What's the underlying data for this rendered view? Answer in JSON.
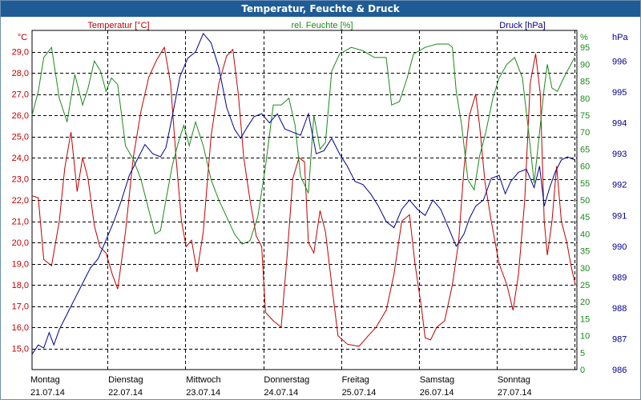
{
  "title": "Temperatur, Feuchte & Druck",
  "colors": {
    "temperature": "#c00000",
    "humidity": "#1a8a1a",
    "pressure": "#00008b",
    "titlebar": "#1f5c95",
    "grid": "#000000"
  },
  "chart_data": {
    "type": "line",
    "title": "Temperatur, Feuchte & Druck",
    "x_ticks": [
      {
        "day": "Montag",
        "date": "21.07.14"
      },
      {
        "day": "Dienstag",
        "date": "22.07.14"
      },
      {
        "day": "Mittwoch",
        "date": "23.07.14"
      },
      {
        "day": "Donnerstag",
        "date": "24.07.14"
      },
      {
        "day": "Freitag",
        "date": "25.07.14"
      },
      {
        "day": "Samstag",
        "date": "26.07.14"
      },
      {
        "day": "Sonntag",
        "date": "27.07.14"
      }
    ],
    "axes": {
      "temperature": {
        "label": "Temperatur [°C]",
        "unit": "°C",
        "ticks": [
          "15,0",
          "16,0",
          "17,0",
          "18,0",
          "19,0",
          "20,0",
          "21,0",
          "22,0",
          "23,0",
          "24,0",
          "25,0",
          "26,0",
          "27,0",
          "28,0",
          "29,0"
        ],
        "range": [
          14.0,
          30.0
        ]
      },
      "humidity": {
        "label": "rel. Feuchte [%]",
        "unit": "%",
        "ticks": [
          "0",
          "5",
          "10",
          "15",
          "20",
          "25",
          "30",
          "35",
          "40",
          "45",
          "50",
          "55",
          "60",
          "65",
          "70",
          "75",
          "80",
          "85",
          "90",
          "95"
        ],
        "range": [
          0,
          100
        ]
      },
      "pressure": {
        "label": "Druck [hPa]",
        "unit": "hPa",
        "ticks": [
          "986",
          "987",
          "988",
          "989",
          "990",
          "991",
          "992",
          "993",
          "994",
          "995",
          "996"
        ],
        "range": [
          986,
          997
        ]
      }
    },
    "grid": true,
    "x_range_days": [
      0,
      7
    ],
    "series": [
      {
        "name": "Temperatur [°C]",
        "axis": "temperature",
        "points": [
          [
            0,
            22.2
          ],
          [
            0.08,
            22.1
          ],
          [
            0.15,
            19.2
          ],
          [
            0.25,
            18.9
          ],
          [
            0.35,
            21.0
          ],
          [
            0.42,
            23.5
          ],
          [
            0.5,
            25.2
          ],
          [
            0.58,
            22.4
          ],
          [
            0.65,
            24.0
          ],
          [
            0.72,
            23.0
          ],
          [
            0.8,
            20.8
          ],
          [
            0.87,
            19.8
          ],
          [
            0.95,
            19.5
          ],
          [
            1.03,
            18.5
          ],
          [
            1.1,
            17.8
          ],
          [
            1.2,
            20.5
          ],
          [
            1.3,
            24.0
          ],
          [
            1.4,
            26.2
          ],
          [
            1.5,
            27.8
          ],
          [
            1.6,
            28.6
          ],
          [
            1.7,
            29.2
          ],
          [
            1.78,
            27.5
          ],
          [
            1.85,
            24.0
          ],
          [
            1.92,
            21.0
          ],
          [
            1.98,
            19.8
          ],
          [
            2.05,
            20.1
          ],
          [
            2.12,
            18.6
          ],
          [
            2.2,
            20.5
          ],
          [
            2.3,
            25.0
          ],
          [
            2.4,
            27.5
          ],
          [
            2.5,
            28.8
          ],
          [
            2.58,
            29.1
          ],
          [
            2.65,
            27.0
          ],
          [
            2.72,
            24.0
          ],
          [
            2.8,
            22.0
          ],
          [
            2.88,
            20.3
          ],
          [
            2.95,
            19.8
          ],
          [
            3.0,
            16.7
          ],
          [
            3.1,
            16.3
          ],
          [
            3.2,
            16.0
          ],
          [
            3.28,
            19.5
          ],
          [
            3.35,
            23.0
          ],
          [
            3.43,
            24.0
          ],
          [
            3.5,
            23.8
          ],
          [
            3.55,
            20.0
          ],
          [
            3.62,
            19.5
          ],
          [
            3.7,
            21.5
          ],
          [
            3.77,
            20.5
          ],
          [
            3.85,
            18.0
          ],
          [
            3.93,
            15.6
          ],
          [
            4.05,
            15.2
          ],
          [
            4.2,
            15.1
          ],
          [
            4.32,
            15.6
          ],
          [
            4.42,
            16.0
          ],
          [
            4.55,
            16.8
          ],
          [
            4.65,
            18.5
          ],
          [
            4.75,
            21.0
          ],
          [
            4.85,
            21.3
          ],
          [
            4.92,
            19.0
          ],
          [
            5.0,
            17.0
          ],
          [
            5.05,
            15.5
          ],
          [
            5.12,
            15.4
          ],
          [
            5.2,
            16.0
          ],
          [
            5.3,
            16.3
          ],
          [
            5.4,
            18.0
          ],
          [
            5.48,
            20.0
          ],
          [
            5.55,
            23.5
          ],
          [
            5.62,
            26.0
          ],
          [
            5.7,
            27.0
          ],
          [
            5.75,
            25.5
          ],
          [
            5.82,
            22.8
          ],
          [
            5.9,
            21.0
          ],
          [
            6.0,
            19.0
          ],
          [
            6.1,
            18.0
          ],
          [
            6.18,
            16.8
          ],
          [
            6.25,
            18.5
          ],
          [
            6.33,
            22.0
          ],
          [
            6.4,
            27.5
          ],
          [
            6.47,
            28.9
          ],
          [
            6.53,
            27.0
          ],
          [
            6.58,
            21.0
          ],
          [
            6.62,
            19.4
          ],
          [
            6.68,
            21.0
          ],
          [
            6.74,
            23.6
          ],
          [
            6.8,
            21.0
          ],
          [
            6.87,
            20.0
          ],
          [
            6.93,
            18.8
          ],
          [
            6.98,
            18.0
          ]
        ]
      },
      {
        "name": "rel. Feuchte [%]",
        "axis": "humidity",
        "points": [
          [
            0,
            75
          ],
          [
            0.08,
            82
          ],
          [
            0.15,
            92
          ],
          [
            0.25,
            95
          ],
          [
            0.35,
            80
          ],
          [
            0.45,
            73
          ],
          [
            0.55,
            87
          ],
          [
            0.65,
            78
          ],
          [
            0.72,
            83
          ],
          [
            0.8,
            91
          ],
          [
            0.88,
            88
          ],
          [
            0.95,
            82
          ],
          [
            1.02,
            86
          ],
          [
            1.1,
            84
          ],
          [
            1.2,
            66
          ],
          [
            1.3,
            62
          ],
          [
            1.4,
            56
          ],
          [
            1.5,
            47
          ],
          [
            1.58,
            40
          ],
          [
            1.65,
            41
          ],
          [
            1.72,
            50
          ],
          [
            1.8,
            60
          ],
          [
            1.88,
            67
          ],
          [
            1.95,
            72
          ],
          [
            2.02,
            66
          ],
          [
            2.1,
            73
          ],
          [
            2.2,
            66
          ],
          [
            2.3,
            56
          ],
          [
            2.4,
            50
          ],
          [
            2.5,
            45
          ],
          [
            2.6,
            40
          ],
          [
            2.7,
            37
          ],
          [
            2.8,
            38
          ],
          [
            2.9,
            45
          ],
          [
            3.0,
            60
          ],
          [
            3.1,
            78
          ],
          [
            3.2,
            78
          ],
          [
            3.3,
            80
          ],
          [
            3.38,
            72
          ],
          [
            3.45,
            57
          ],
          [
            3.55,
            52
          ],
          [
            3.62,
            75
          ],
          [
            3.7,
            65
          ],
          [
            3.77,
            67
          ],
          [
            3.85,
            88
          ],
          [
            3.95,
            93
          ],
          [
            4.1,
            95
          ],
          [
            4.25,
            94
          ],
          [
            4.4,
            92
          ],
          [
            4.55,
            92
          ],
          [
            4.62,
            78
          ],
          [
            4.72,
            79
          ],
          [
            4.82,
            86
          ],
          [
            4.9,
            93
          ],
          [
            5.05,
            95
          ],
          [
            5.2,
            96
          ],
          [
            5.35,
            96
          ],
          [
            5.4,
            95
          ],
          [
            5.45,
            82
          ],
          [
            5.52,
            72
          ],
          [
            5.6,
            56
          ],
          [
            5.68,
            53
          ],
          [
            5.75,
            63
          ],
          [
            5.83,
            70
          ],
          [
            5.92,
            80
          ],
          [
            6.0,
            86
          ],
          [
            6.1,
            90
          ],
          [
            6.2,
            92
          ],
          [
            6.3,
            86
          ],
          [
            6.38,
            70
          ],
          [
            6.45,
            55
          ],
          [
            6.52,
            70
          ],
          [
            6.58,
            83
          ],
          [
            6.62,
            90
          ],
          [
            6.68,
            83
          ],
          [
            6.75,
            82
          ],
          [
            6.83,
            86
          ],
          [
            6.9,
            89
          ],
          [
            6.97,
            92
          ]
        ]
      },
      {
        "name": "Druck [hPa]",
        "axis": "pressure",
        "points": [
          [
            0,
            986.5
          ],
          [
            0.08,
            986.8
          ],
          [
            0.15,
            986.7
          ],
          [
            0.22,
            987.2
          ],
          [
            0.28,
            986.8
          ],
          [
            0.35,
            987.3
          ],
          [
            0.45,
            987.8
          ],
          [
            0.55,
            988.3
          ],
          [
            0.65,
            988.8
          ],
          [
            0.75,
            989.3
          ],
          [
            0.85,
            989.6
          ],
          [
            0.95,
            990.2
          ],
          [
            1.05,
            990.8
          ],
          [
            1.15,
            991.5
          ],
          [
            1.25,
            992.3
          ],
          [
            1.35,
            992.8
          ],
          [
            1.45,
            993.3
          ],
          [
            1.55,
            993.0
          ],
          [
            1.65,
            992.9
          ],
          [
            1.72,
            993.2
          ],
          [
            1.8,
            994.2
          ],
          [
            1.9,
            995.5
          ],
          [
            2.0,
            996.1
          ],
          [
            2.1,
            996.3
          ],
          [
            2.2,
            996.9
          ],
          [
            2.3,
            996.6
          ],
          [
            2.4,
            995.8
          ],
          [
            2.5,
            994.5
          ],
          [
            2.6,
            993.8
          ],
          [
            2.68,
            993.5
          ],
          [
            2.75,
            993.8
          ],
          [
            2.85,
            994.2
          ],
          [
            2.95,
            994.3
          ],
          [
            3.05,
            994.0
          ],
          [
            3.15,
            994.3
          ],
          [
            3.25,
            993.8
          ],
          [
            3.35,
            993.7
          ],
          [
            3.45,
            993.6
          ],
          [
            3.55,
            994.3
          ],
          [
            3.65,
            993.0
          ],
          [
            3.75,
            993.1
          ],
          [
            3.85,
            993.5
          ],
          [
            3.95,
            993.0
          ],
          [
            4.05,
            992.6
          ],
          [
            4.15,
            992.1
          ],
          [
            4.25,
            992.0
          ],
          [
            4.35,
            991.7
          ],
          [
            4.45,
            991.3
          ],
          [
            4.55,
            990.8
          ],
          [
            4.65,
            990.6
          ],
          [
            4.75,
            991.2
          ],
          [
            4.85,
            991.5
          ],
          [
            4.95,
            991.2
          ],
          [
            5.05,
            991.0
          ],
          [
            5.15,
            991.5
          ],
          [
            5.25,
            991.2
          ],
          [
            5.35,
            990.6
          ],
          [
            5.45,
            990.0
          ],
          [
            5.55,
            990.4
          ],
          [
            5.62,
            990.9
          ],
          [
            5.7,
            991.3
          ],
          [
            5.8,
            991.5
          ],
          [
            5.9,
            992.2
          ],
          [
            6.0,
            992.3
          ],
          [
            6.08,
            991.7
          ],
          [
            6.15,
            992.1
          ],
          [
            6.25,
            992.4
          ],
          [
            6.35,
            992.5
          ],
          [
            6.45,
            991.9
          ],
          [
            6.52,
            992.6
          ],
          [
            6.58,
            991.3
          ],
          [
            6.65,
            991.9
          ],
          [
            6.72,
            992.4
          ],
          [
            6.8,
            992.8
          ],
          [
            6.88,
            992.9
          ],
          [
            6.97,
            992.8
          ]
        ]
      }
    ]
  }
}
